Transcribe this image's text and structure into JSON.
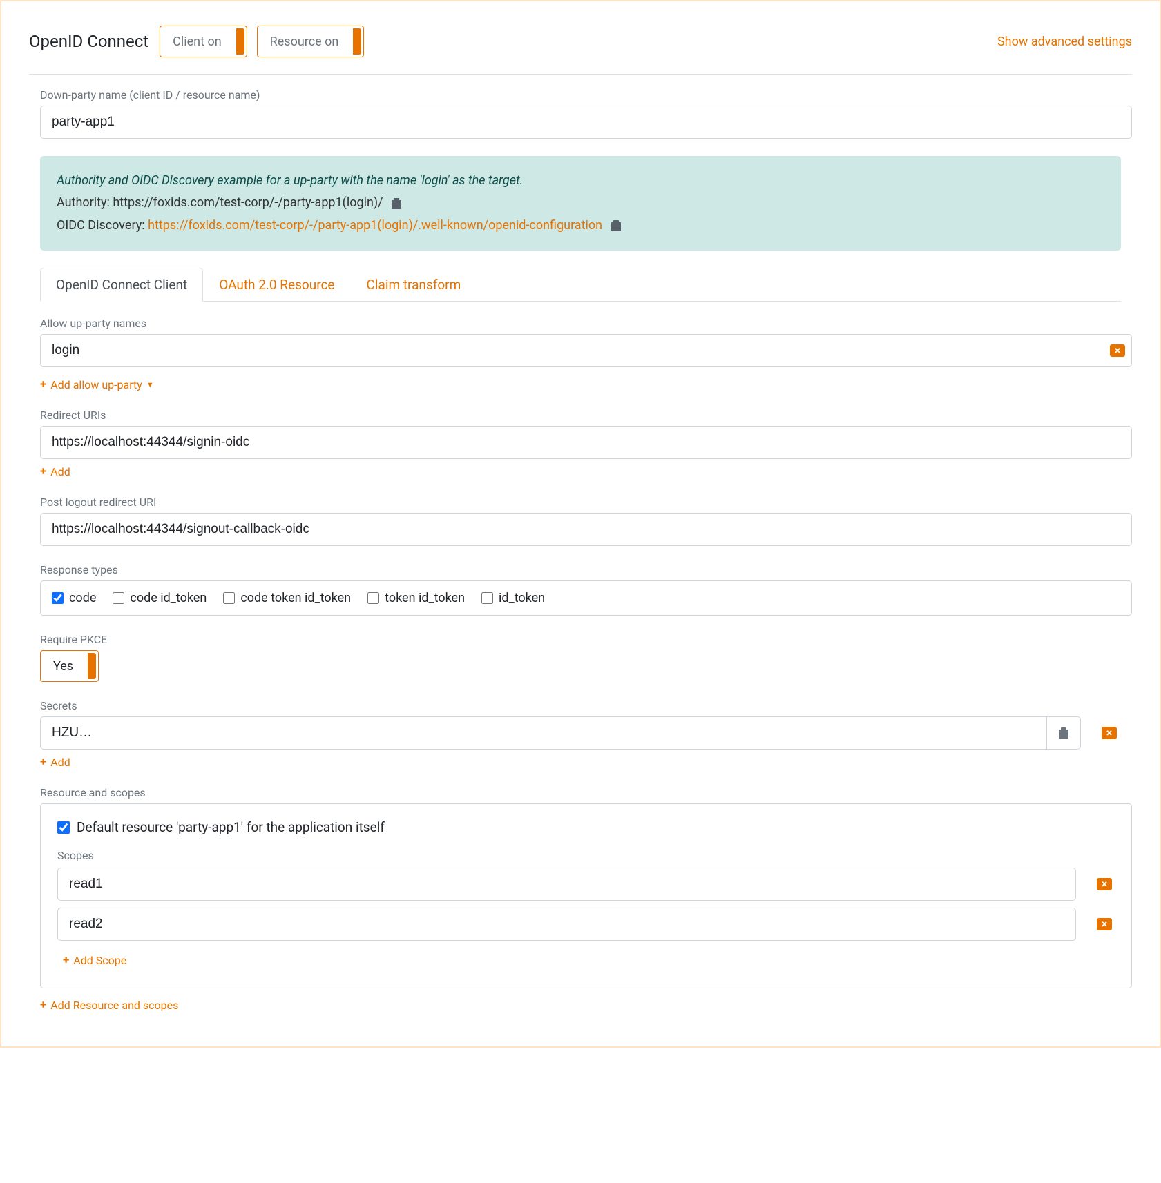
{
  "header": {
    "title": "OpenID Connect",
    "toggle_client": "Client on",
    "toggle_resource": "Resource on",
    "advanced_link": "Show advanced settings"
  },
  "down_party": {
    "label": "Down-party name (client ID / resource name)",
    "value": "party-app1"
  },
  "info": {
    "line1": "Authority and OIDC Discovery example for a up-party with the name 'login' as the target.",
    "authority_label": "Authority: ",
    "authority_url": "https://foxids.com/test-corp/-/party-app1(login)/",
    "discovery_label": "OIDC Discovery: ",
    "discovery_url": "https://foxids.com/test-corp/-/party-app1(login)/.well-known/openid-configuration"
  },
  "tabs": {
    "client": "OpenID Connect Client",
    "resource": "OAuth 2.0 Resource",
    "claim": "Claim transform"
  },
  "up_party": {
    "label": "Allow up-party names",
    "value": "login",
    "add": "Add allow up-party"
  },
  "redirect": {
    "label": "Redirect URIs",
    "value": "https://localhost:44344/signin-oidc",
    "add": "Add"
  },
  "post_logout": {
    "label": "Post logout redirect URI",
    "value": "https://localhost:44344/signout-callback-oidc"
  },
  "response_types": {
    "label": "Response types",
    "options": {
      "code": "code",
      "code_id_token": "code id_token",
      "code_token_id_token": "code token id_token",
      "token_id_token": "token id_token",
      "id_token": "id_token"
    }
  },
  "pkce": {
    "label": "Require PKCE",
    "value": "Yes"
  },
  "secrets": {
    "label": "Secrets",
    "value": "HZU…",
    "add": "Add"
  },
  "resource_scopes": {
    "label": "Resource and scopes",
    "default_label": "Default resource 'party-app1' for the application itself",
    "scopes_label": "Scopes",
    "scopes": [
      "read1",
      "read2"
    ],
    "add_scope": "Add Scope",
    "add_resource": "Add Resource and scopes"
  }
}
